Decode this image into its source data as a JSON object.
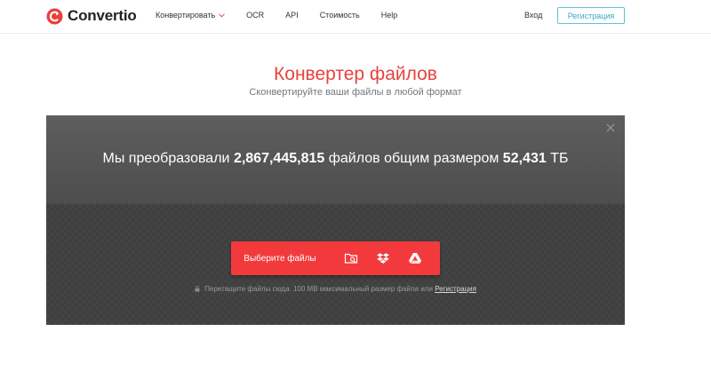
{
  "brand": {
    "name": "Convertio",
    "accent": "#e8413f"
  },
  "nav": {
    "items": [
      {
        "label": "Конвертировать",
        "has_dropdown": true,
        "icon": "chevron-down-icon"
      },
      {
        "label": "OCR"
      },
      {
        "label": "API"
      },
      {
        "label": "Стоимость"
      },
      {
        "label": "Help"
      }
    ],
    "login_label": "Вход",
    "signup_label": "Регистрация"
  },
  "hero": {
    "title": "Конвертер файлов",
    "subtitle": "Сконвертируйте ваши файлы в любой формат"
  },
  "converter": {
    "stats_prefix": "Мы преобразовали",
    "files_count": "2,867,445,815",
    "stats_middle": "файлов общим размером",
    "total_size": "52,431",
    "size_unit": "ТБ",
    "choose_files_label": "Выберите файлы",
    "sources": [
      {
        "icon": "folder-search-icon",
        "name": "computer"
      },
      {
        "icon": "dropbox-icon",
        "name": "dropbox"
      },
      {
        "icon": "google-drive-icon",
        "name": "google-drive"
      }
    ],
    "drop_hint": "Перетащите файлы сюда. 100 MB максимальный размер файла или",
    "drop_hint_link": "Регистрация",
    "button_color": "#f23a3c"
  }
}
